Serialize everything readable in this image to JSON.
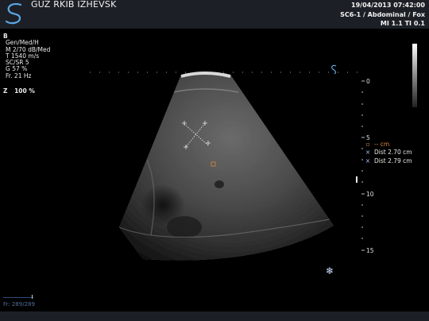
{
  "header": {
    "clinic": "GUZ RKIB IZHEVSK",
    "datetime": "19/04/2013 07:42:00",
    "probe": "SC6-1 / Abdominal / Fox",
    "indices": "MI 1.1   TI 0.1"
  },
  "params": {
    "mode": "B",
    "lines": [
      "Gen/Med/H",
      "M 2/70 dB/Med",
      "T 1540 m/s",
      "SC/SR 5",
      "G 57 %",
      "Fr. 21 Hz"
    ]
  },
  "zoom": {
    "label": "Z",
    "value": "100  %"
  },
  "depth_labels": [
    "0",
    "5",
    "10",
    "15"
  ],
  "measurements": [
    {
      "symbol": "▫",
      "text": "-- cm",
      "color": "orange"
    },
    {
      "symbol": "×",
      "text": "Dist 2.70 cm",
      "color": "blue"
    },
    {
      "symbol": "×",
      "text": "Dist 2.79 cm",
      "color": "blue"
    }
  ],
  "frame_counter": "Fr: 289/289",
  "icons": {
    "logo": "manufacturer-logo-icon",
    "freeze": "snowflake-icon",
    "orientation": "probe-orientation-icon"
  }
}
